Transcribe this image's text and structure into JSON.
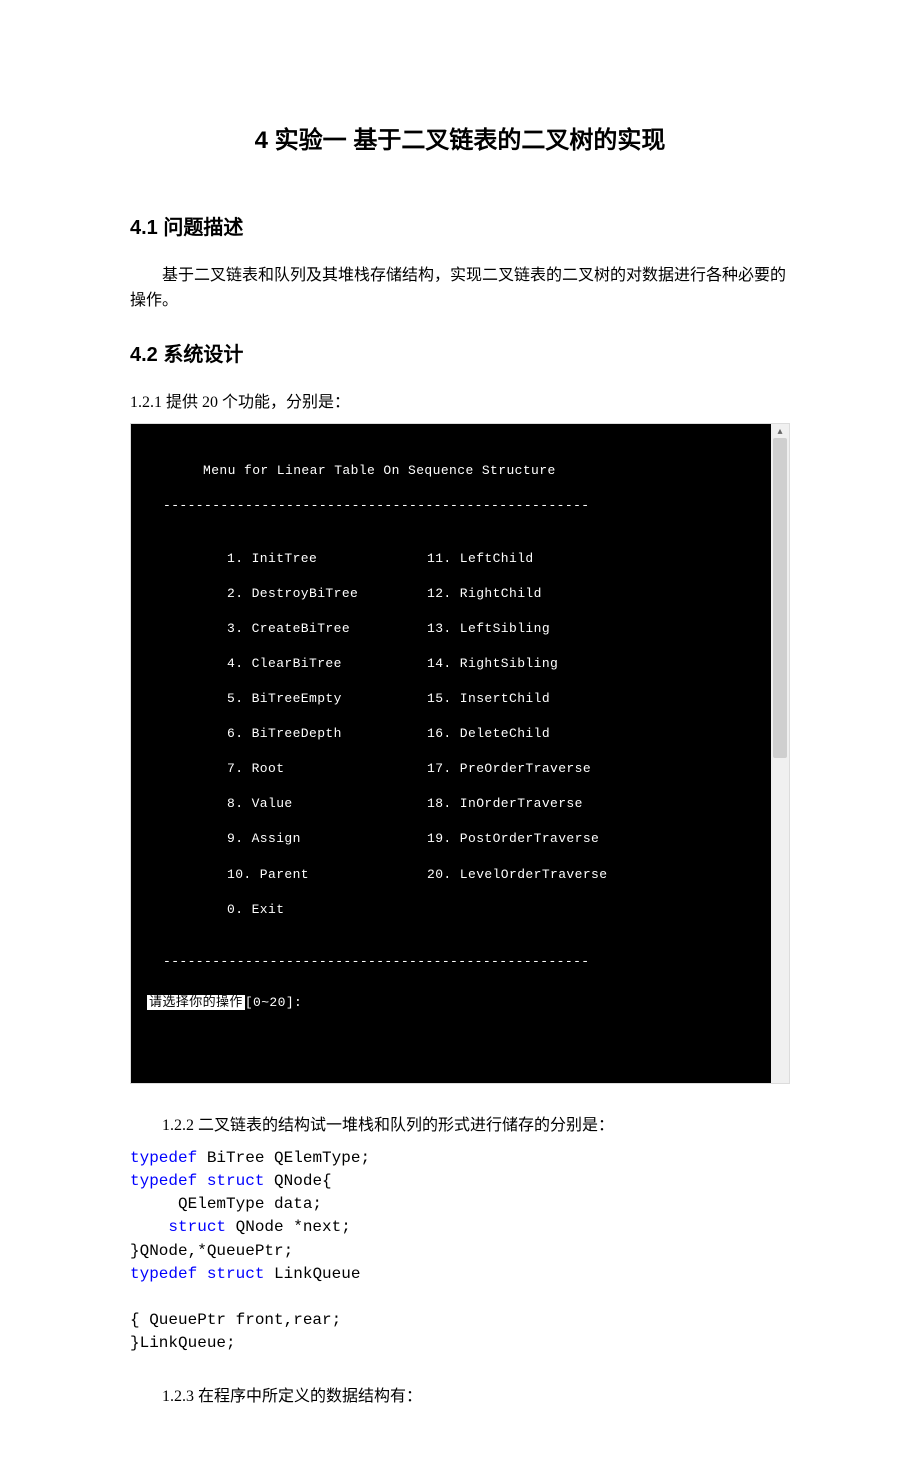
{
  "title": "4 实验一 基于二叉链表的二叉树的实现",
  "sec1": {
    "heading": "4.1 问题描述",
    "body": "基于二叉链表和队列及其堆栈存储结构，实现二叉链表的二叉树的对数据进行各种必要的操作。"
  },
  "sec2": {
    "heading": "4.2 系统设计",
    "intro": "1.2.1 提供 20 个功能，分别是：",
    "console": {
      "menu_title": "Menu for Linear Table On Sequence Structure",
      "rule": "----------------------------------------------------",
      "items_left": [
        "1. InitTree",
        "2. DestroyBiTree",
        "3. CreateBiTree",
        "4. ClearBiTree",
        "5. BiTreeEmpty",
        "6. BiTreeDepth",
        "7. Root",
        "8. Value",
        "9. Assign",
        "10. Parent",
        "0. Exit"
      ],
      "items_right": [
        "11. LeftChild",
        "12. RightChild",
        "13. LeftSibling",
        "14. RightSibling",
        "15. InsertChild",
        "16. DeleteChild",
        "17. PreOrderTraverse",
        "18. InOrderTraverse",
        "19. PostOrderTraverse",
        "20. LevelOrderTraverse",
        ""
      ],
      "prompt_hl": "请选择你的操作",
      "prompt_tail": "[0~20]:"
    },
    "para122": "1.2.2 二叉链表的结构试一堆栈和队列的形式进行储存的分别是：",
    "code": {
      "l1_kw": "typedef",
      "l1_rest": " BiTree QElemType;",
      "l2_kw1": "typedef",
      "l2_kw2": " struct",
      "l2_rest": " QNode{",
      "l3": "     QElemType data;",
      "l4_kw": "    struct",
      "l4_rest": " QNode *next;",
      "l5": "}QNode,*QueuePtr;",
      "l6_kw1": "typedef",
      "l6_kw2": " struct",
      "l6_rest": " LinkQueue",
      "l7": "",
      "l8": "{ QueuePtr front,rear;",
      "l9": "}LinkQueue;"
    },
    "para123": "1.2.3 在程序中所定义的数据结构有："
  }
}
